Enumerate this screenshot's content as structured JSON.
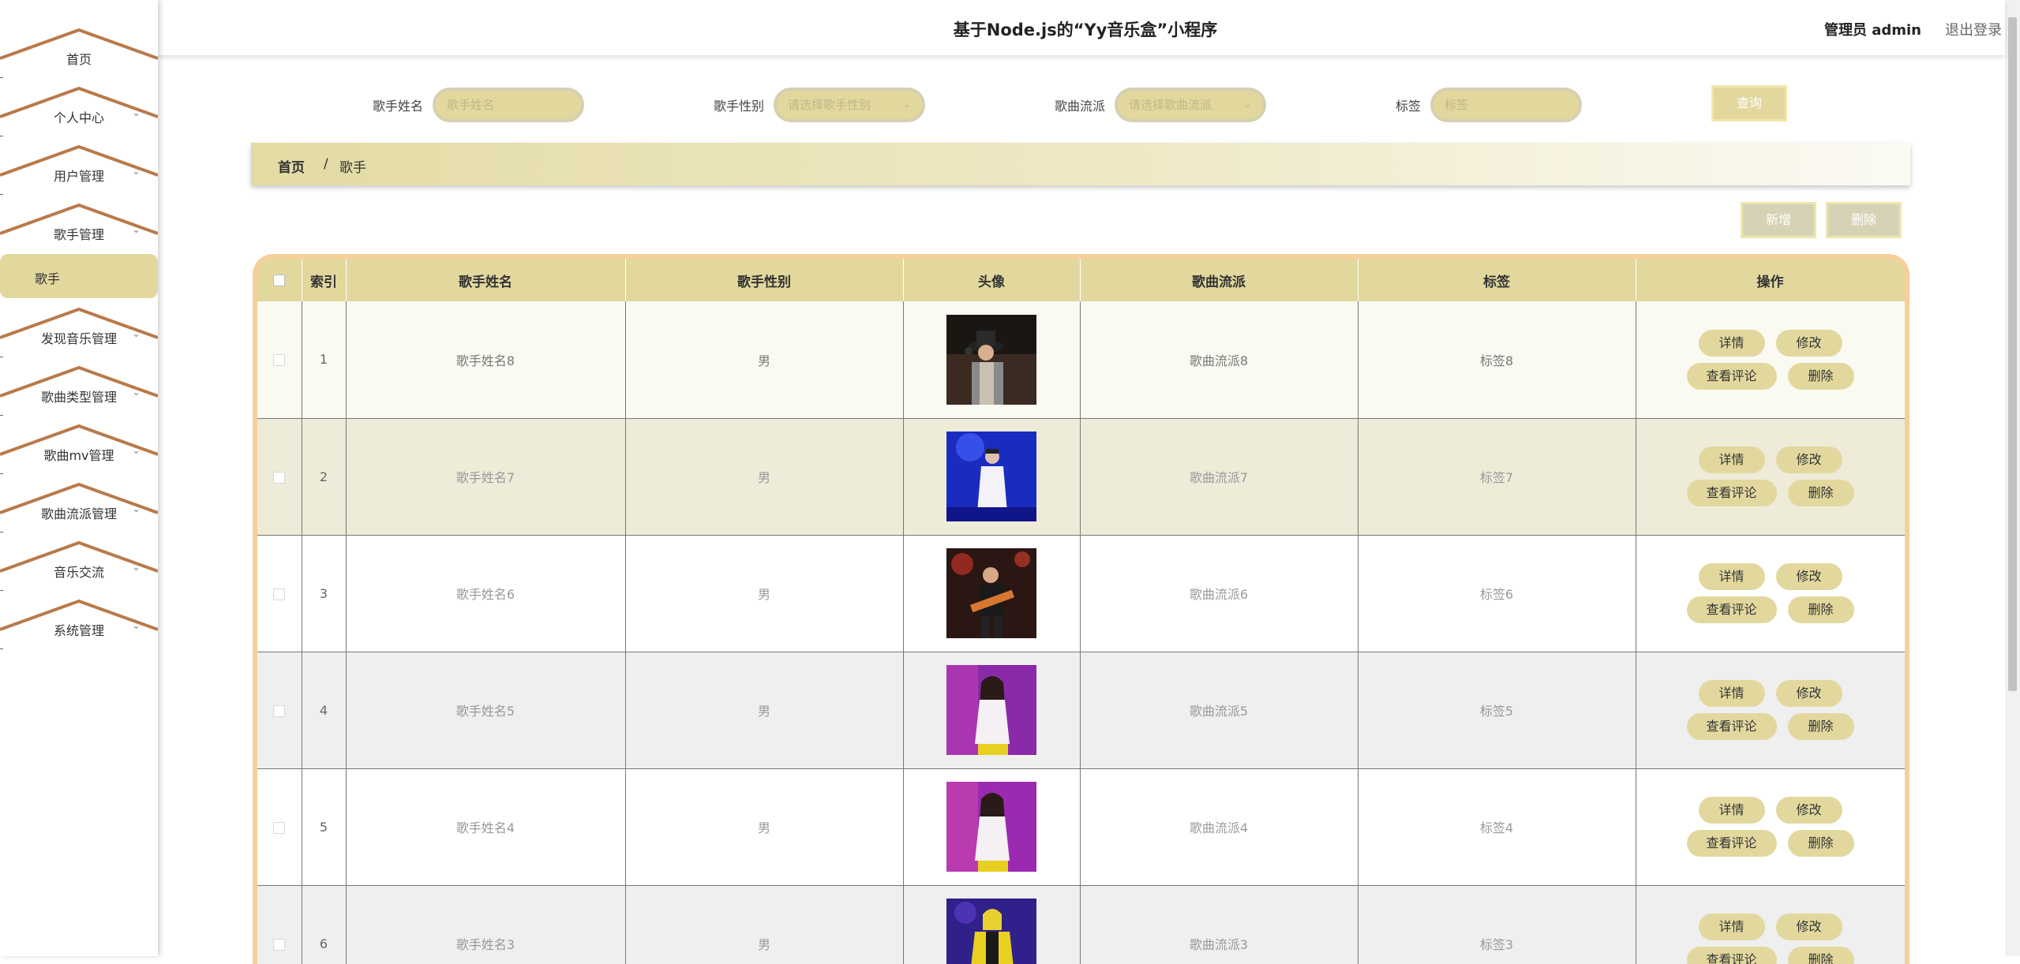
{
  "header": {
    "title": "基于Node.js的“Yy音乐盒”小程序",
    "user": "管理员 admin",
    "logout": "退出登录"
  },
  "sidebar": {
    "items": [
      {
        "label": "首页",
        "chevron": ""
      },
      {
        "label": "个人中心",
        "chevron": "⌄"
      },
      {
        "label": "用户管理",
        "chevron": "⌄"
      },
      {
        "label": "歌手管理",
        "chevron": "⌄"
      },
      {
        "label": "发现音乐管理",
        "chevron": "⌄"
      },
      {
        "label": "歌曲类型管理",
        "chevron": "⌄"
      },
      {
        "label": "歌曲mv管理",
        "chevron": "⌄"
      },
      {
        "label": "歌曲流派管理",
        "chevron": "⌄"
      },
      {
        "label": "音乐交流",
        "chevron": "⌄"
      },
      {
        "label": "系统管理",
        "chevron": "⌄"
      }
    ],
    "active_sub": "歌手"
  },
  "search": {
    "name_label": "歌手姓名",
    "name_placeholder": "歌手姓名",
    "gender_label": "歌手性别",
    "gender_placeholder": "请选择歌手性别",
    "genre_label": "歌曲流派",
    "genre_placeholder": "请选择歌曲流派",
    "tag_label": "标签",
    "tag_placeholder": "标签",
    "query_button": "查询"
  },
  "breadcrumb": {
    "home": "首页",
    "sep": "/",
    "current": "歌手"
  },
  "actions": {
    "add": "新增",
    "delete": "删除"
  },
  "table": {
    "headers": [
      "索引",
      "歌手姓名",
      "歌手性别",
      "头像",
      "歌曲流派",
      "标签",
      "操作"
    ],
    "op_labels": {
      "detail": "详情",
      "edit": "修改",
      "comments": "查看评论",
      "delete": "删除"
    },
    "rows": [
      {
        "index": "1",
        "name": "歌手姓名8",
        "gender": "男",
        "genre": "歌曲流派8",
        "tag": "标签8"
      },
      {
        "index": "2",
        "name": "歌手姓名7",
        "gender": "男",
        "genre": "歌曲流派7",
        "tag": "标签7"
      },
      {
        "index": "3",
        "name": "歌手姓名6",
        "gender": "男",
        "genre": "歌曲流派6",
        "tag": "标签6"
      },
      {
        "index": "4",
        "name": "歌手姓名5",
        "gender": "男",
        "genre": "歌曲流派5",
        "tag": "标签5"
      },
      {
        "index": "5",
        "name": "歌手姓名4",
        "gender": "男",
        "genre": "歌曲流派4",
        "tag": "标签4"
      },
      {
        "index": "6",
        "name": "歌手姓名3",
        "gender": "男",
        "genre": "歌曲流派3",
        "tag": "标签3"
      }
    ]
  },
  "colors": {
    "accent": "#e2d89e",
    "border": "#f6cf9b",
    "menu_line": "#b87a4b"
  }
}
